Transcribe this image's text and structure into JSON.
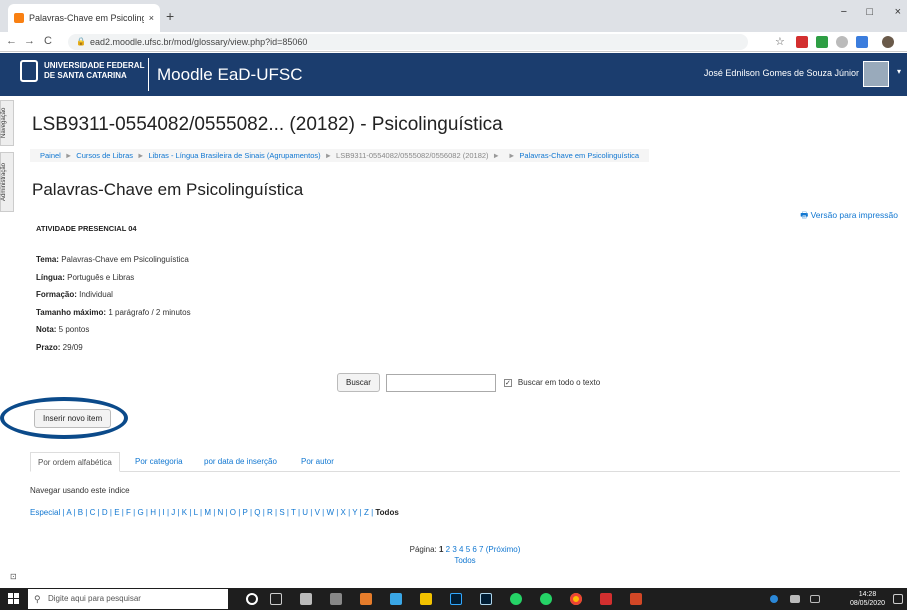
{
  "browser": {
    "tab_title": "Palavras-Chave em Psicolinguíst",
    "tab_close": "×",
    "new_tab": "+",
    "url": "ead2.moodle.ufsc.br/mod/glossary/view.php?id=85060",
    "back": "←",
    "forward": "→",
    "reload": "C",
    "star": "☆",
    "minimize": "−",
    "maximize": "□",
    "close": "×"
  },
  "header": {
    "institution_line1": "UNIVERSIDADE FEDERAL",
    "institution_line2": "DE SANTA CATARINA",
    "site_name": "Moodle EaD-UFSC",
    "user_name": "José Ednilson Gomes de Souza Júnior",
    "caret": "▾"
  },
  "side_tabs": {
    "navigation": "Navegação",
    "administration": "Administração"
  },
  "course_title": "LSB9311-0554082/0555082... (20182) - Psicolinguística",
  "breadcrumb": [
    "Painel",
    "Cursos de Libras",
    "Libras - Língua Brasileira de Sinais (Agrupamentos)",
    "LSB9311-0554082/0555082/0556082 (20182)",
    "",
    "Palavras-Chave em Psicolinguística"
  ],
  "breadcrumb_sep": "►",
  "page_title": "Palavras-Chave em Psicolinguística",
  "print_link": "Versão para impressão",
  "activity_label": "ATIVIDADE PRESENCIAL 04",
  "info": [
    {
      "label": "Tema:",
      "value": " Palavras-Chave em Psicolinguística"
    },
    {
      "label": "Língua:",
      "value": " Português e Libras"
    },
    {
      "label": "Formação:",
      "value": " Individual"
    },
    {
      "label": "Tamanho máximo:",
      "value": " 1 parágrafo / 2 minutos"
    },
    {
      "label": "Nota:",
      "value": " 5 pontos"
    },
    {
      "label": "Prazo:",
      "value": " 29/09"
    }
  ],
  "search": {
    "button": "Buscar",
    "value": "",
    "full_text_label": "Buscar em todo o texto",
    "check": "✓"
  },
  "insert_button": "Inserir novo item",
  "tabs": [
    "Por ordem alfabética",
    "Por categoria",
    "por data de inserção",
    "Por autor"
  ],
  "nav_index_label": "Navegar usando este índice",
  "letters": "Especial | A | B | C | D | E | F | G | H | I | J | K | L | M | N | O | P | Q | R | S | T | U | V | W | X | Y | Z | ",
  "letters_all": "Todos",
  "pager": {
    "label": "Página:",
    "current": "1",
    "pages": "2 3 4 5 6 7",
    "next": "(Próximo)",
    "all": "Todos"
  },
  "taskbar": {
    "search_placeholder": "Digite aqui para pesquisar",
    "time": "14:28",
    "date": "08/05/2020"
  },
  "colors": {
    "header_bg": "#1b3d6e",
    "link": "#1177d1",
    "highlight_oval": "#0b4a8a"
  }
}
